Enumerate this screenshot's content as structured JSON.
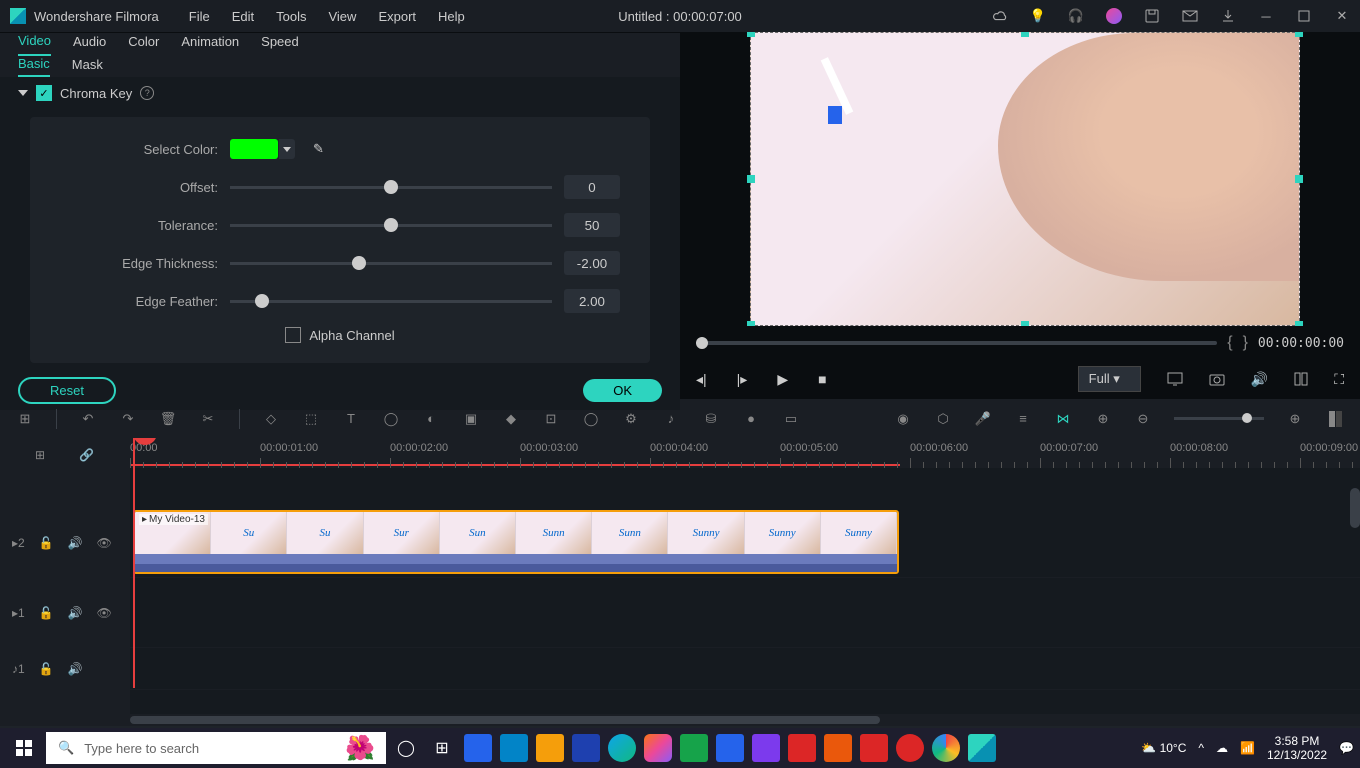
{
  "app": {
    "name": "Wondershare Filmora",
    "title": "Untitled : 00:00:07:00"
  },
  "menu": [
    "File",
    "Edit",
    "Tools",
    "View",
    "Export",
    "Help"
  ],
  "prop_tabs": [
    "Video",
    "Audio",
    "Color",
    "Animation",
    "Speed"
  ],
  "sub_tabs": [
    "Basic",
    "Mask"
  ],
  "chroma": {
    "title": "Chroma Key",
    "select_color_label": "Select Color:",
    "color": "#00ff00",
    "offset": {
      "label": "Offset:",
      "value": "0",
      "pos": 50
    },
    "tolerance": {
      "label": "Tolerance:",
      "value": "50",
      "pos": 50
    },
    "edge_thickness": {
      "label": "Edge Thickness:",
      "value": "-2.00",
      "pos": 40
    },
    "edge_feather": {
      "label": "Edge Feather:",
      "value": "2.00",
      "pos": 10
    },
    "alpha_label": "Alpha Channel"
  },
  "actions": {
    "reset": "Reset",
    "ok": "OK"
  },
  "preview": {
    "timecode": "00:00:00:00",
    "quality": "Full"
  },
  "timeline": {
    "marks": [
      "00:00",
      "00:00:01:00",
      "00:00:02:00",
      "00:00:03:00",
      "00:00:04:00",
      "00:00:05:00",
      "00:00:06:00",
      "00:00:07:00",
      "00:00:08:00",
      "00:00:09:00"
    ],
    "clip_name": "My Video-13",
    "clip_words": [
      "",
      "Su",
      "Su",
      "Sur",
      "Sun",
      "Sunn",
      "Sunn",
      "Sunny",
      "Sunny",
      "Sunny"
    ]
  },
  "taskbar": {
    "search_placeholder": "Type here to search",
    "temp": "10°C",
    "time": "3:58 PM",
    "date": "12/13/2022"
  }
}
